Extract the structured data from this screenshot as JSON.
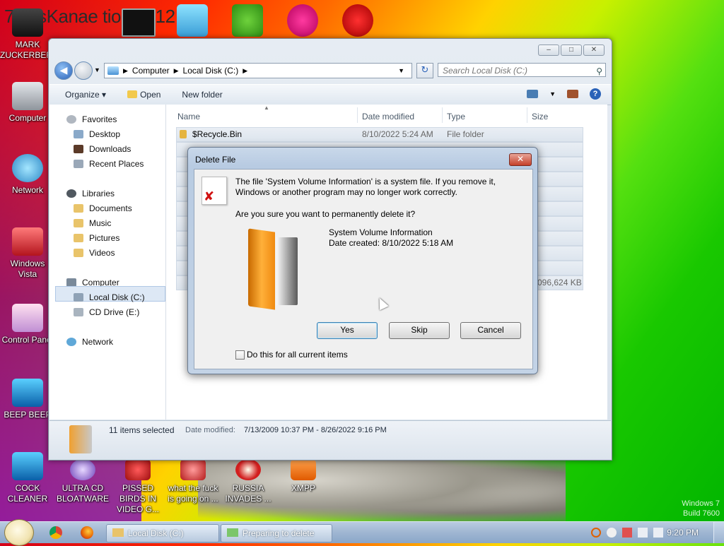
{
  "desktop": {
    "top_title": "7 ossKanae tion 2012",
    "icons": [
      {
        "label": "MARK ZUCKERBERG"
      },
      {
        "label": "Computer"
      },
      {
        "label": "Network"
      },
      {
        "label": "Windows Vista"
      },
      {
        "label": "Control Panel"
      },
      {
        "label": "BEEP BEEP"
      },
      {
        "label": "COCK CLEANER"
      },
      {
        "label": "ULTRA CD BLOATWARE"
      },
      {
        "label": "PISSED BIRDS IN VIDEO G..."
      },
      {
        "label": "what the fuck is going on ..."
      },
      {
        "label": "RUSSIA INVADES ..."
      },
      {
        "label": "XMPP"
      }
    ],
    "top_icons": [
      "cmd-icon",
      "drive-icon",
      "angry-birds-icon",
      "p-icon",
      "dev-cpp-icon"
    ],
    "watermark": {
      "line1": "Windows 7",
      "line2": "Build 7600"
    }
  },
  "explorer": {
    "breadcrumb": [
      "Computer",
      "Local Disk (C:)"
    ],
    "search_placeholder": "Search Local Disk (C:)",
    "toolbar": {
      "organize": "Organize",
      "open": "Open",
      "new_folder": "New folder"
    },
    "nav": {
      "favorites": "Favorites",
      "desktop": "Desktop",
      "downloads": "Downloads",
      "recent_places": "Recent Places",
      "libraries": "Libraries",
      "documents": "Documents",
      "music": "Music",
      "pictures": "Pictures",
      "videos": "Videos",
      "computer": "Computer",
      "local_disk": "Local Disk (C:)",
      "cd_drive": "CD Drive (E:)",
      "network": "Network"
    },
    "columns": {
      "name": "Name",
      "date_modified": "Date modified",
      "type": "Type",
      "size": "Size"
    },
    "first_row": {
      "name": "$Recycle.Bin",
      "date": "8/10/2022 5:24 AM",
      "type": "File folder"
    },
    "partial_size": "096,624 KB",
    "details": {
      "selected": "11 items selected",
      "date_label": "Date modified:",
      "date_range": "7/13/2009 10:37 PM - 8/26/2022 9:16 PM"
    }
  },
  "dialog": {
    "title": "Delete File",
    "message": "The file 'System Volume Information' is a system file. If you remove it, Windows or another program may no longer work correctly.",
    "question": "Are you sure you want to permanently delete it?",
    "item_name": "System Volume Information",
    "item_date": "Date created: 8/10/2022 5:18 AM",
    "yes": "Yes",
    "skip": "Skip",
    "cancel": "Cancel",
    "checkbox_label": "Do this for all current items"
  },
  "taskbar": {
    "task1": "Local Disk (C:)",
    "task2": "Preparing to delete",
    "time": "9:20 PM"
  }
}
